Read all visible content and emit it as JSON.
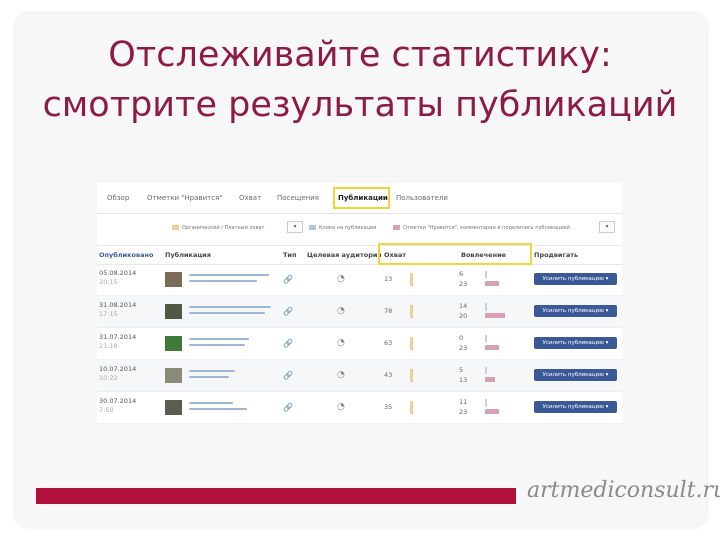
{
  "slide": {
    "title_line1": "Отслеживайте статистику:",
    "title_line2": "смотрите результаты публикаций",
    "footer_logo": "artmediconsult.ru"
  },
  "colors": {
    "title": "#8e1b47",
    "footer_bar": "#b0103a",
    "highlight": "#f2d43a",
    "button": "#3b5998"
  },
  "tabs": [
    "Обзор",
    "Отметки \"Нравится\"",
    "Охват",
    "Посещения",
    "Публикации",
    "Пользователи"
  ],
  "active_tab": "Публикации",
  "legend": [
    {
      "label": "Органический / Платный охват",
      "color": "#f1cf92"
    },
    {
      "label": "Клики на публикации",
      "color": "#b8c4e6"
    },
    {
      "label": "Отметки \"Нравится\", комментарии и поделились публикацией",
      "color": "#d6a0b5"
    }
  ],
  "table_headers": [
    "Опубликовано",
    "Публикация",
    "Тип",
    "Целевая аудитория",
    "Охват",
    "Вовлечение",
    "Продвигать"
  ],
  "rows": [
    {
      "date": "05.08.2014",
      "time": "20:15",
      "reach": "13",
      "engagement": [
        "6",
        "23"
      ],
      "button": "Усилить публикацию"
    },
    {
      "date": "31.08.2014",
      "time": "17:15",
      "reach": "78",
      "engagement": [
        "14",
        "20"
      ],
      "button": "Усилить публикацию"
    },
    {
      "date": "31.07.2014",
      "time": "21:18",
      "reach": "63",
      "engagement": [
        "0",
        "23"
      ],
      "button": "Усилить публикацию"
    },
    {
      "date": "10.07.2014",
      "time": "10:22",
      "reach": "43",
      "engagement": [
        "5",
        "13"
      ],
      "button": "Усилить публикацию"
    },
    {
      "date": "30.07.2014",
      "time": "7:50",
      "reach": "35",
      "engagement": [
        "11",
        "23"
      ],
      "button": "Усилить публикацию"
    }
  ],
  "icons": {
    "type": "link-icon",
    "target": "target-audience-icon",
    "dropdown": "chevron-down-icon"
  }
}
